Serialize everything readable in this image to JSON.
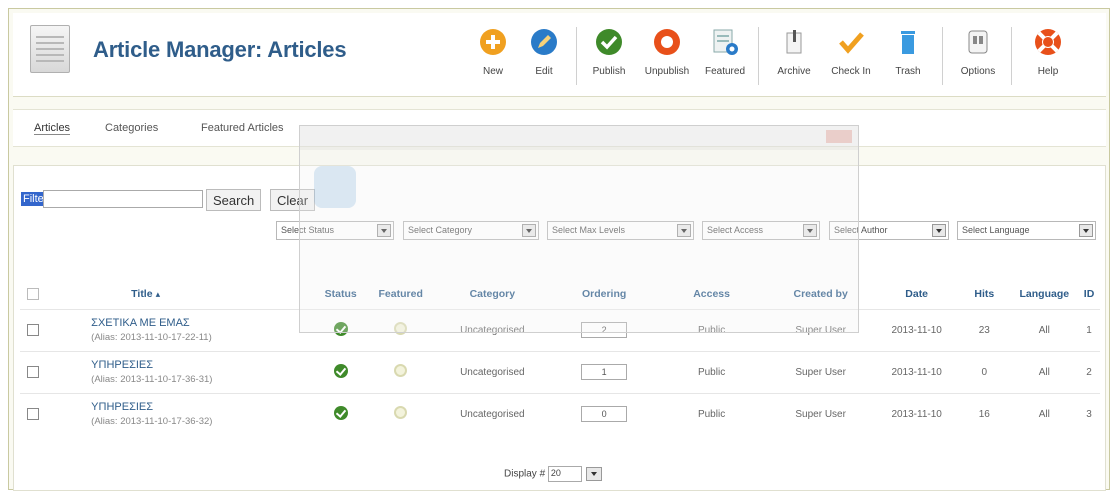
{
  "header": {
    "title": "Article Manager: Articles"
  },
  "toolbar": {
    "buttons": [
      {
        "label": "New",
        "icon": "new-icon",
        "color": "#f0a020"
      },
      {
        "label": "Edit",
        "icon": "edit-icon",
        "color": "#2a7bc8"
      },
      {
        "label": "Publish",
        "icon": "publish-icon",
        "color": "#3f8a2a"
      },
      {
        "label": "Unpublish",
        "icon": "unpublish-icon",
        "color": "#e8501a"
      },
      {
        "label": "Featured",
        "icon": "featured-icon",
        "color": "#8aa"
      },
      {
        "label": "Archive",
        "icon": "archive-icon",
        "color": "#888"
      },
      {
        "label": "Check In",
        "icon": "checkin-icon",
        "color": "#f0a020"
      },
      {
        "label": "Trash",
        "icon": "trash-icon",
        "color": "#3a9ae0"
      },
      {
        "label": "Options",
        "icon": "options-icon",
        "color": "#888"
      },
      {
        "label": "Help",
        "icon": "help-icon",
        "color": "#e8501a"
      }
    ]
  },
  "subnav": {
    "tabs": [
      "Articles",
      "Categories",
      "Featured Articles"
    ],
    "active": "Articles"
  },
  "filter": {
    "label": "Filter",
    "value": "",
    "search_label": "Search",
    "clear_label": "Clear"
  },
  "selects": [
    "Select Status",
    "Select Category",
    "Select Max Levels",
    "Select Access",
    "Select Author",
    "Select Language"
  ],
  "table": {
    "headers": {
      "title": "Title",
      "status": "Status",
      "featured": "Featured",
      "category": "Category",
      "ordering": "Ordering",
      "access": "Access",
      "created_by": "Created by",
      "date": "Date",
      "hits": "Hits",
      "language": "Language",
      "id": "ID"
    },
    "rows": [
      {
        "title": "ΣΧΕΤΙΚΑ ΜΕ ΕΜΑΣ",
        "alias": "(Alias: 2013-11-10-17-22-11)",
        "category": "Uncategorised",
        "ordering": "2",
        "access": "Public",
        "created_by": "Super User",
        "date": "2013-11-10",
        "hits": "23",
        "language": "All",
        "id": "1"
      },
      {
        "title": "ΥΠΗΡΕΣΙΕΣ",
        "alias": "(Alias: 2013-11-10-17-36-31)",
        "category": "Uncategorised",
        "ordering": "1",
        "access": "Public",
        "created_by": "Super User",
        "date": "2013-11-10",
        "hits": "0",
        "language": "All",
        "id": "2"
      },
      {
        "title": "ΥΠΗΡΕΣΙΕΣ",
        "alias": "(Alias: 2013-11-10-17-36-32)",
        "category": "Uncategorised",
        "ordering": "0",
        "access": "Public",
        "created_by": "Super User",
        "date": "2013-11-10",
        "hits": "16",
        "language": "All",
        "id": "3"
      }
    ]
  },
  "pager": {
    "label": "Display #",
    "value": "20"
  }
}
